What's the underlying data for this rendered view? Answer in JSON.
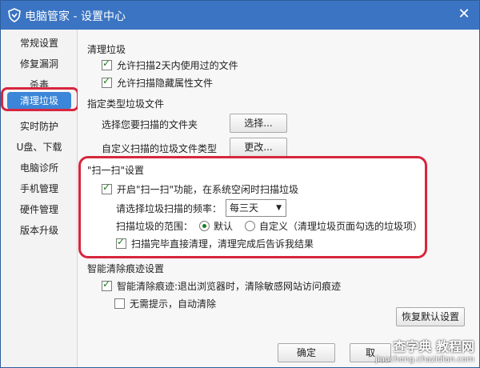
{
  "window": {
    "title": "电脑管家 - 设置中心"
  },
  "sidebar": {
    "items": [
      {
        "label": "常规设置"
      },
      {
        "label": "修复漏洞"
      },
      {
        "label": "杀毒"
      },
      {
        "label": "清理垃圾",
        "active": true
      },
      {
        "label": "实时防护"
      },
      {
        "label": "U盘、下载"
      },
      {
        "label": "电脑诊所"
      },
      {
        "label": "手机管理"
      },
      {
        "label": "硬件管理"
      },
      {
        "label": "版本升级"
      }
    ]
  },
  "clean": {
    "title": "清理垃圾",
    "opt1": "允许扫描2天内使用过的文件",
    "opt2": "允许扫描隐藏属性文件"
  },
  "types": {
    "title": "指定类型垃圾文件",
    "folder_label": "选择您要扫描的文件夹",
    "folder_btn": "选择...",
    "custom_label": "自定义扫描的垃圾文件类型",
    "custom_btn": "更改..."
  },
  "scan": {
    "title": "\"扫一扫\"设置",
    "enable": "开启\"扫一扫\"功能，在系统空闲时扫描垃圾",
    "freq_label": "请选择垃圾扫描的频率：",
    "freq_value": "每三天",
    "range_label": "扫描垃圾的范围：",
    "range_default": "默认",
    "range_custom": "自定义（清理垃圾页面勾选的垃圾项）",
    "direct": "扫描完毕直接清理，清理完成后告诉我结果"
  },
  "trace": {
    "title": "智能清除痕迹设置",
    "opt1": "智能清除痕迹:退出浏览器时，清除敏感网站访问痕迹",
    "opt2": "无需提示，自动清除"
  },
  "footer": {
    "restore_btn": "恢复默认设置",
    "ok_btn": "确定",
    "cancel_btn": "取"
  },
  "watermark": {
    "line1": "查字典 教程网",
    "line2": "jiaocheng.chazidian.com"
  }
}
